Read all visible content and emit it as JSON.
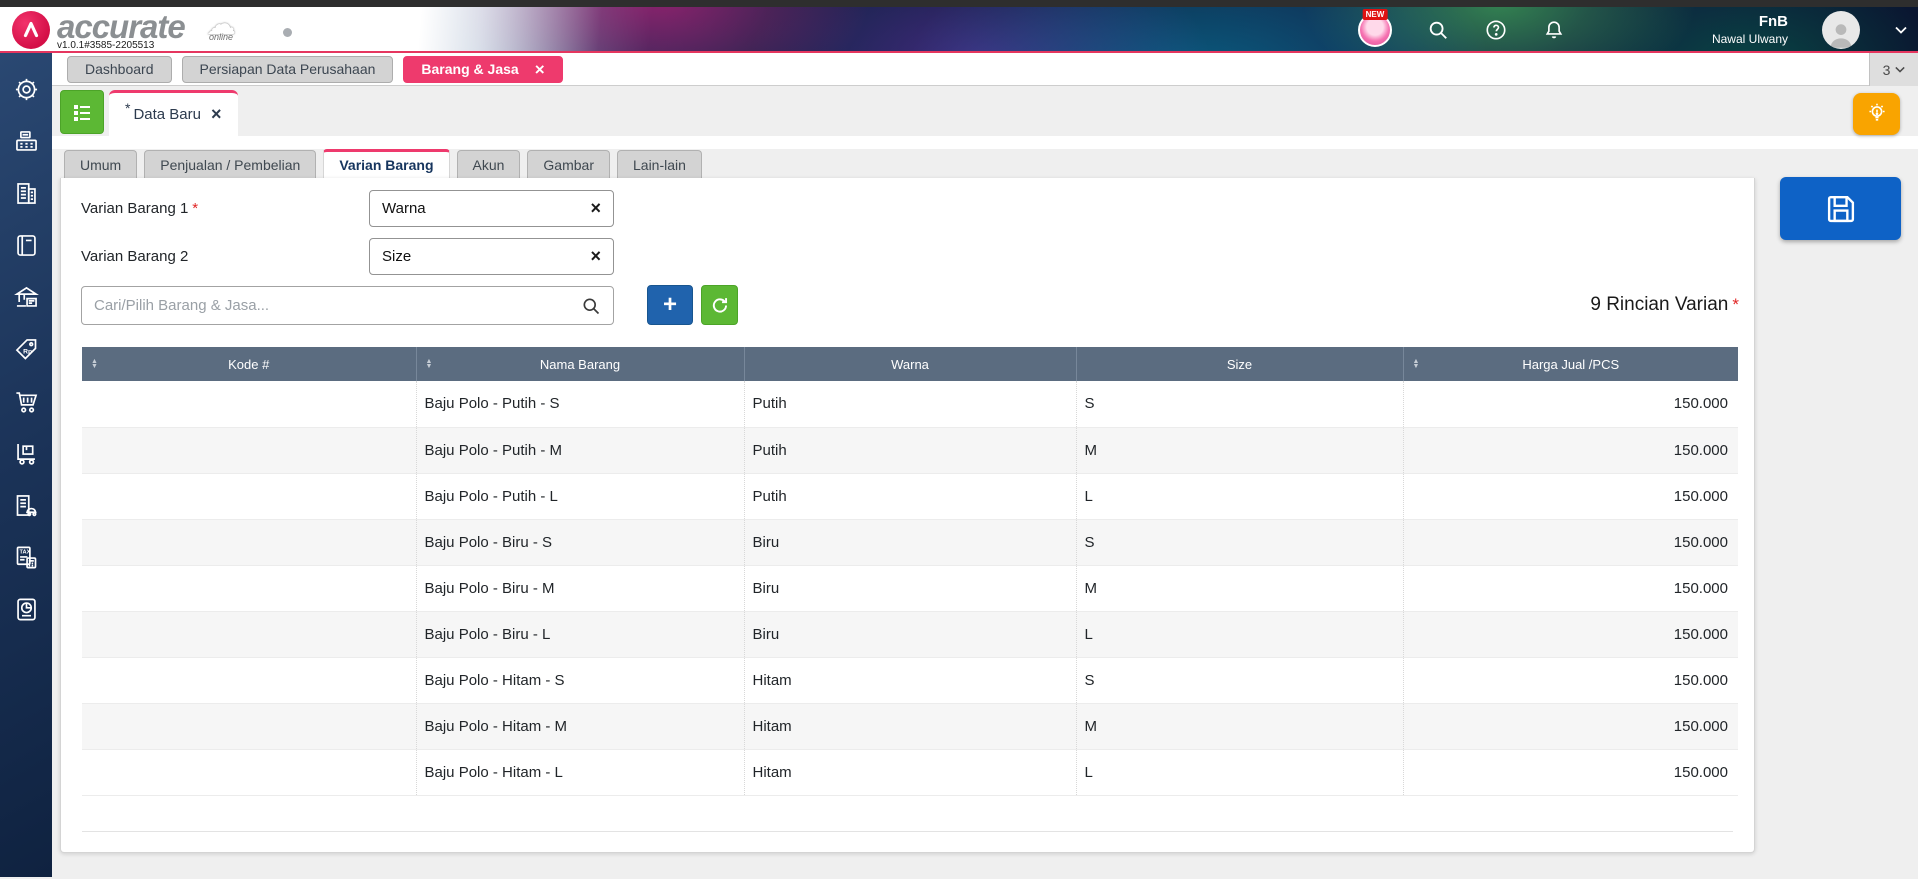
{
  "app": {
    "brand": "accurate",
    "brand_sub": "online",
    "version": "v1.0.1#3585-2205513",
    "company": "FnB",
    "user": "Nawal Ulwany",
    "new_badge": "NEW"
  },
  "window_tabs": {
    "items": [
      {
        "label": "Dashboard",
        "active": false
      },
      {
        "label": "Persiapan Data Perusahaan",
        "active": false
      },
      {
        "label": "Barang & Jasa",
        "active": true
      }
    ],
    "open_count": "3"
  },
  "doc_tab": {
    "dirty_marker": "*",
    "label": "Data Baru"
  },
  "page_tabs": {
    "items": [
      {
        "label": "Umum",
        "active": false
      },
      {
        "label": "Penjualan / Pembelian",
        "active": false
      },
      {
        "label": "Varian Barang",
        "active": true
      },
      {
        "label": "Akun",
        "active": false
      },
      {
        "label": "Gambar",
        "active": false
      },
      {
        "label": "Lain-lain",
        "active": false
      }
    ]
  },
  "form": {
    "variant1_label": "Varian Barang 1",
    "variant2_label": "Varian Barang 2",
    "required_marker": "*",
    "variant1_value": "Warna",
    "variant2_value": "Size",
    "search_placeholder": "Cari/Pilih Barang & Jasa...",
    "add_button_label": "+",
    "summary_label": "9 Rincian Varian"
  },
  "table": {
    "columns": [
      "Kode #",
      "Nama Barang",
      "Warna",
      "Size",
      "Harga Jual /PCS"
    ],
    "sortable_columns": [
      "Kode #",
      "Nama Barang",
      "Harga Jual /PCS"
    ],
    "rows": [
      {
        "kode": "",
        "nama": "Baju Polo - Putih - S",
        "warna": "Putih",
        "size": "S",
        "harga": "150.000"
      },
      {
        "kode": "",
        "nama": "Baju Polo - Putih - M",
        "warna": "Putih",
        "size": "M",
        "harga": "150.000"
      },
      {
        "kode": "",
        "nama": "Baju Polo - Putih - L",
        "warna": "Putih",
        "size": "L",
        "harga": "150.000"
      },
      {
        "kode": "",
        "nama": "Baju Polo - Biru - S",
        "warna": "Biru",
        "size": "S",
        "harga": "150.000"
      },
      {
        "kode": "",
        "nama": "Baju Polo - Biru - M",
        "warna": "Biru",
        "size": "M",
        "harga": "150.000"
      },
      {
        "kode": "",
        "nama": "Baju Polo - Biru - L",
        "warna": "Biru",
        "size": "L",
        "harga": "150.000"
      },
      {
        "kode": "",
        "nama": "Baju Polo - Hitam - S",
        "warna": "Hitam",
        "size": "S",
        "harga": "150.000"
      },
      {
        "kode": "",
        "nama": "Baju Polo - Hitam - M",
        "warna": "Hitam",
        "size": "M",
        "harga": "150.000"
      },
      {
        "kode": "",
        "nama": "Baju Polo - Hitam - L",
        "warna": "Hitam",
        "size": "L",
        "harga": "150.000"
      }
    ]
  },
  "sidebar": {
    "icons": [
      "settings",
      "pos-cash-register",
      "company",
      "ledger-book",
      "bank-cash",
      "price-tag-rp",
      "purchases-cart",
      "inventory-delivery",
      "fixed-assets",
      "tax",
      "reports"
    ],
    "tag_text": "Rp",
    "tax_text": "TAX"
  },
  "icons": {
    "close": "×",
    "sort_up": "▲",
    "sort_down": "▼",
    "logo_caret": "∧",
    "cloud": "☁"
  },
  "colors": {
    "accent_pink": "#ee3a6d",
    "table_header": "#5b6c80",
    "green": "#5cb834",
    "blue": "#2063ad",
    "save_blue": "#0e62c6",
    "warning_yellow": "#f9a400",
    "sidebar_navy": "#1b3358",
    "required_red": "#e02424"
  }
}
